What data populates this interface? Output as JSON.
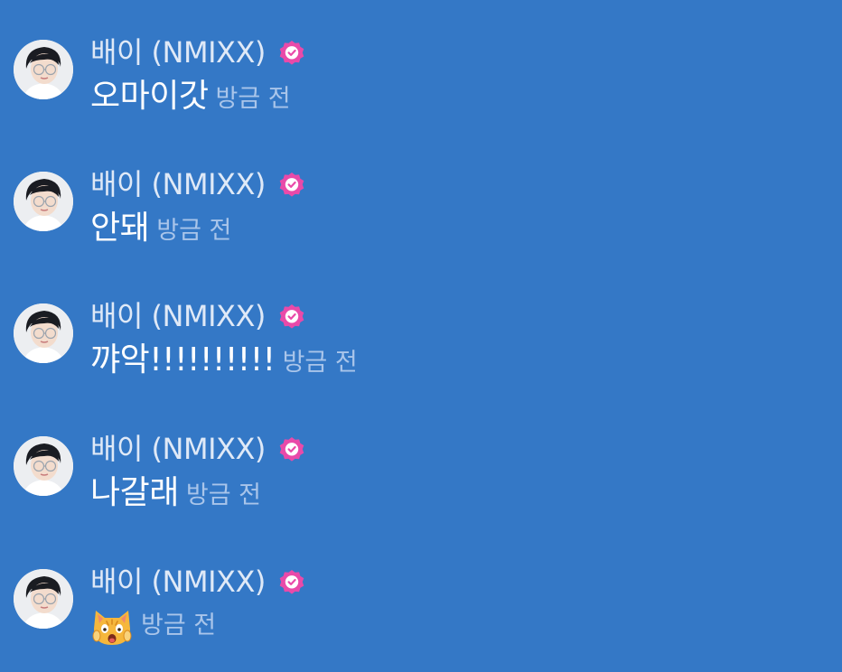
{
  "colors": {
    "background": "#3478c6",
    "author_text": "#dfe9f7",
    "message_text": "#ffffff",
    "timestamp_text": "#a9c5ea",
    "verified_badge": "#e94aa9"
  },
  "messages": [
    {
      "author": "배이 (NMIXX)",
      "verified_icon": "verified-badge-icon",
      "text": "오마이갓",
      "time": "방금 전"
    },
    {
      "author": "배이 (NMIXX)",
      "verified_icon": "verified-badge-icon",
      "text": "안돼",
      "time": "방금 전"
    },
    {
      "author": "배이 (NMIXX)",
      "verified_icon": "verified-badge-icon",
      "text": "꺄악!!!!!!!!!!",
      "time": "방금 전"
    },
    {
      "author": "배이 (NMIXX)",
      "verified_icon": "verified-badge-icon",
      "text": "나갈래",
      "time": "방금 전"
    },
    {
      "author": "배이 (NMIXX)",
      "verified_icon": "verified-badge-icon",
      "emoji": "screaming-cat-emoji",
      "time": "방금 전"
    }
  ]
}
